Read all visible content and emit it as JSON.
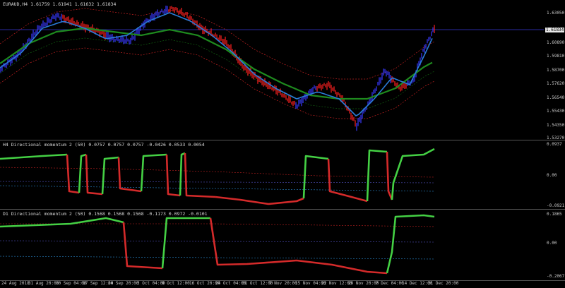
{
  "main_chart": {
    "title": "EURAUD,H4  1.61759 1.61941 1.61632 1.61834",
    "current_price": "1.61834",
    "axis_labels": [
      "1.63050",
      "1.61834",
      "1.60890",
      "1.59810",
      "1.58700",
      "1.57620",
      "1.56540",
      "1.55430",
      "1.54350",
      "1.53270"
    ]
  },
  "h4_indicator": {
    "title": "H4 Directional momentum 2 (50) 0.0757 0.0757 0.0757 -0.0426 0.0533 0.0054",
    "axis_labels": [
      "0.0937",
      "0.00",
      "-0.0921"
    ]
  },
  "d1_indicator": {
    "title": "D1 Directional momentum 2 (50) 0.1568 0.1568 0.1568 -0.1173 0.0972 -0.0101",
    "axis_labels": [
      "0.1865",
      "0.00",
      "-0.2067"
    ]
  },
  "time_axis": [
    "24 Aug 2018",
    "31 Aug 20:00",
    "10 Sep 04:00",
    "17 Sep 12:00",
    "24 Sep 20:00",
    "2 Oct 04:00",
    "9 Oct 12:00",
    "16 Oct 20:00",
    "24 Oct 04:00",
    "31 Oct 12:00",
    "7 Nov 20:00",
    "15 Nov 04:00",
    "22 Nov 12:00",
    "29 Nov 20:00",
    "7 Dec 04:00",
    "14 Dec 12:00",
    "21 Dec 20:00"
  ],
  "colors": {
    "bull": "#3a3aff",
    "bear": "#ff2020",
    "ma_fast": "#2a7bd8",
    "ma_slow": "#1e8a1e",
    "band": "#c02020",
    "up": "#44d044",
    "down": "#d42a2a"
  }
}
